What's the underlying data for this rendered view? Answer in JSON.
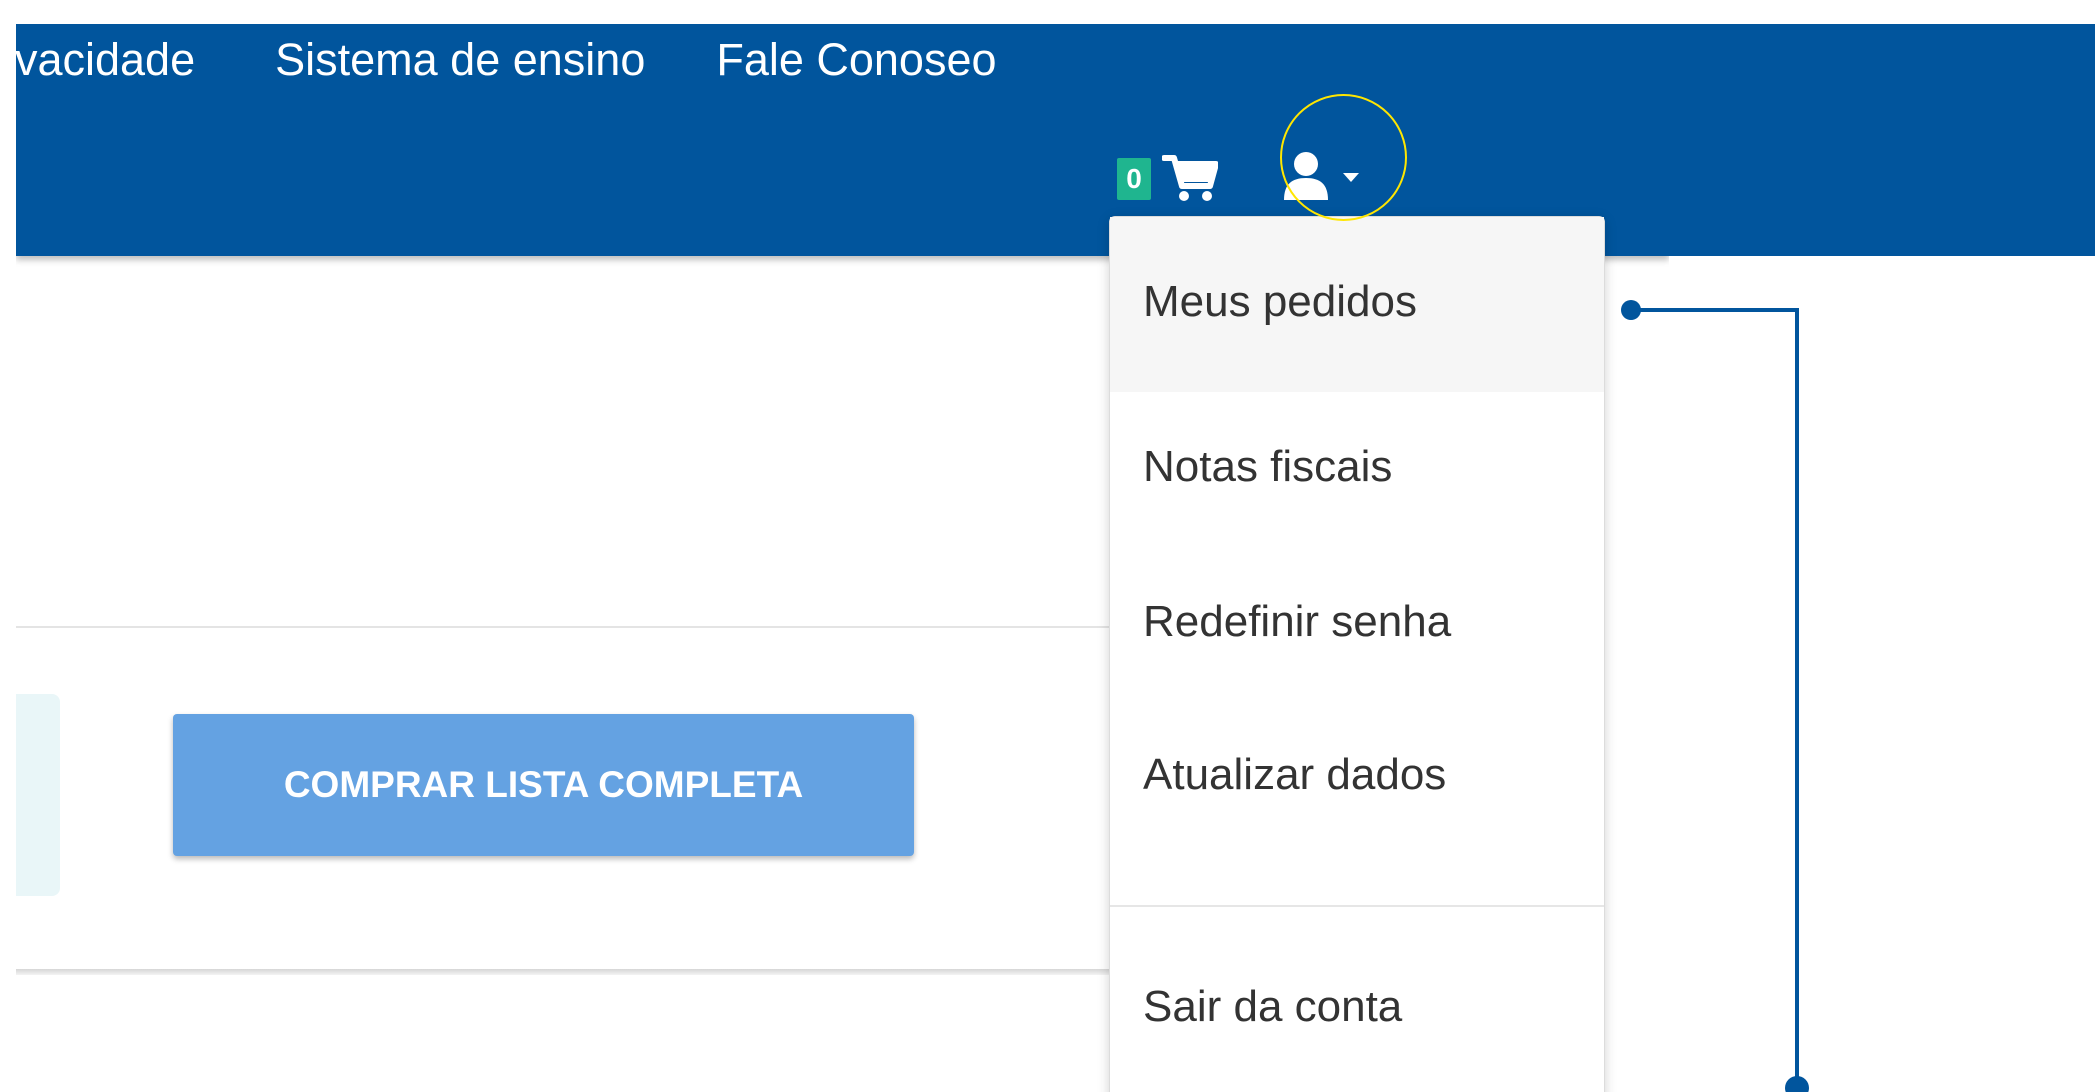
{
  "nav": {
    "links": [
      "rivacidade",
      "Sistema de ensino",
      "Fale Conoseo"
    ],
    "cart_count": "0"
  },
  "icons": {
    "cart": "shopping-cart-icon",
    "user": "user-icon",
    "caret": "caret-down-icon"
  },
  "dropdown": {
    "items": [
      "Meus pedidos",
      "Notas fiscais",
      "Redefinir senha",
      "Atualizar dados",
      "Sair da conta"
    ]
  },
  "main": {
    "buy_button_label": "COMPRAR LISTA COMPLETA"
  },
  "colors": {
    "nav_blue": "#01559d",
    "badge_green": "#1fb58f",
    "button_blue": "#64a2e2",
    "highlight_yellow": "#ffe600"
  }
}
